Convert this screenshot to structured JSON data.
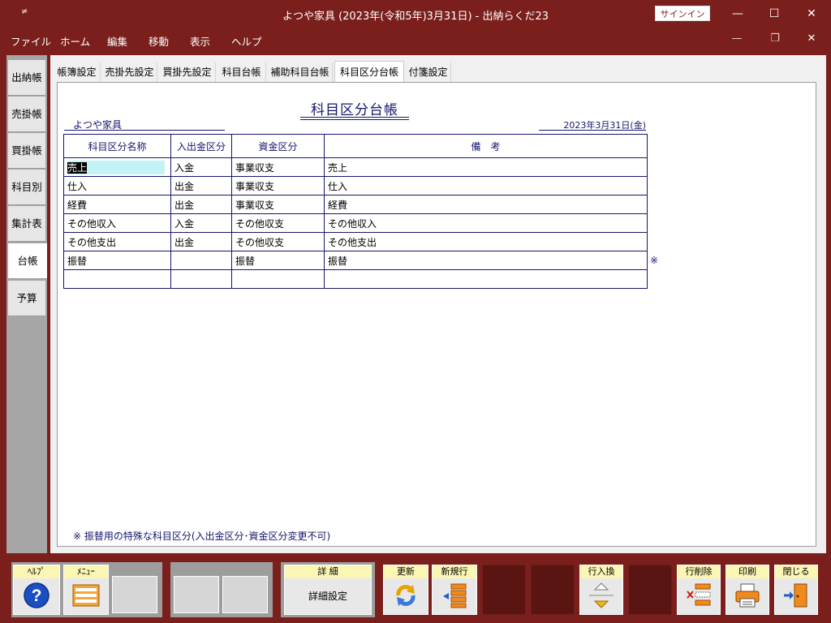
{
  "window": {
    "title": "よつや家具 (2023年(令和5年)3月31日)  -  出納らくだ23",
    "quick_access": "≠",
    "signin": "サインイン",
    "minimize": "—",
    "maximize": "☐",
    "close": "✕"
  },
  "menu": {
    "items": [
      "ファイル",
      "ホーム",
      "編集",
      "移動",
      "表示",
      "ヘルプ"
    ],
    "mdi_minimize": "—",
    "mdi_restore": "❐",
    "mdi_close": "✕"
  },
  "sidebar": {
    "tabs": [
      "出納帳",
      "売掛帳",
      "買掛帳",
      "科目別",
      "集計表",
      "台帳",
      "予算"
    ],
    "active": "台帳"
  },
  "tabs": {
    "items": [
      "帳簿設定",
      "売掛先設定",
      "買掛先設定",
      "科目台帳",
      "補助科目台帳",
      "科目区分台帳",
      "付箋設定"
    ],
    "active": "科目区分台帳"
  },
  "document": {
    "title": "科目区分台帳",
    "company": "よつや家具",
    "date": "2023年3月31日(金)",
    "columns": [
      "科目区分名称",
      "入出金区分",
      "資金区分",
      "備　考"
    ],
    "rows": [
      [
        "売上",
        "入金",
        "事業収支",
        "売上"
      ],
      [
        "仕入",
        "出金",
        "事業収支",
        "仕入"
      ],
      [
        "経費",
        "出金",
        "事業収支",
        "経費"
      ],
      [
        "その他収入",
        "入金",
        "その他収支",
        "その他収入"
      ],
      [
        "その他支出",
        "出金",
        "その他収支",
        "その他支出"
      ],
      [
        "振替",
        "",
        "振替",
        "振替"
      ],
      [
        "",
        "",
        "",
        ""
      ]
    ],
    "row_mark": "※",
    "footnote": "※ 振替用の特殊な科目区分(入出金区分･資金区分変更不可)"
  },
  "toolbar": {
    "help": "ﾍﾙﾌﾟ",
    "menu": "ﾒﾆｭｰ",
    "detail_label": "詳 細",
    "detail_button": "詳細設定",
    "refresh": "更新",
    "new_row": "新規行",
    "swap_rows": "行入換",
    "delete_row": "行削除",
    "print": "印刷",
    "close": "閉じる"
  },
  "colors": {
    "frame": "#7a1f1c",
    "ink": "#15156e",
    "button_label_bg": "#fbf6b4",
    "selection": "#c4f3f6"
  }
}
